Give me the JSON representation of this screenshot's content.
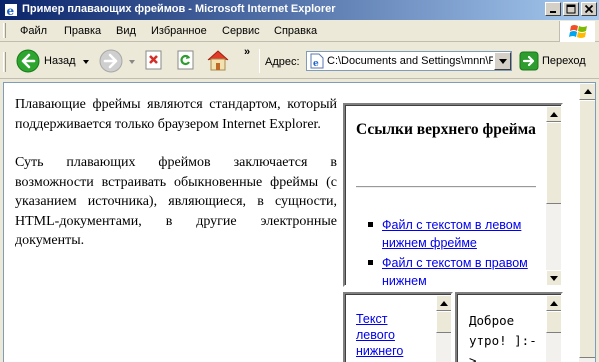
{
  "window": {
    "title": "Пример плавающих фреймов - Microsoft Internet Explorer"
  },
  "menu": {
    "items": [
      "Файл",
      "Правка",
      "Вид",
      "Избранное",
      "Сервис",
      "Справка"
    ]
  },
  "toolbar": {
    "back_label": "Назад",
    "overflow_label": "»",
    "address_label": "Адрес:",
    "address_value": "C:\\Documents and Settings\\mnn\\Ра",
    "go_label": "Переход"
  },
  "content": {
    "paragraphs": [
      "Плавающие фреймы являются стандартом, который поддерживается только браузером Internet Explorer.",
      "Суть плавающих фреймов заключается в возможности встраивать обыкновенные фреймы (с указанием источника), являющиеся, в сущности, HTML-документами, в другие электронные документы."
    ]
  },
  "top_frame": {
    "heading": "Ссылки верхнего фрейма",
    "links": [
      "Файл с текстом в левом нижнем фрейме",
      "Файл с текстом в правом нижнем"
    ]
  },
  "left_frame": {
    "link_text": "Текст левого нижнего"
  },
  "right_frame": {
    "text": "Доброе утро! ]:->"
  },
  "colors": {
    "titlebar": "#0a246a",
    "window_bg": "#ece9d8",
    "link": "#0000ee",
    "go_arrow": "#2e9c2e",
    "back_arrow": "#2ea52e"
  },
  "icons": [
    "ie-icon",
    "minimize-icon",
    "maximize-icon",
    "close-icon",
    "windows-logo-icon",
    "back-arrow-icon",
    "forward-arrow-icon",
    "stop-icon",
    "refresh-icon",
    "home-icon",
    "page-icon",
    "go-arrow-icon"
  ]
}
